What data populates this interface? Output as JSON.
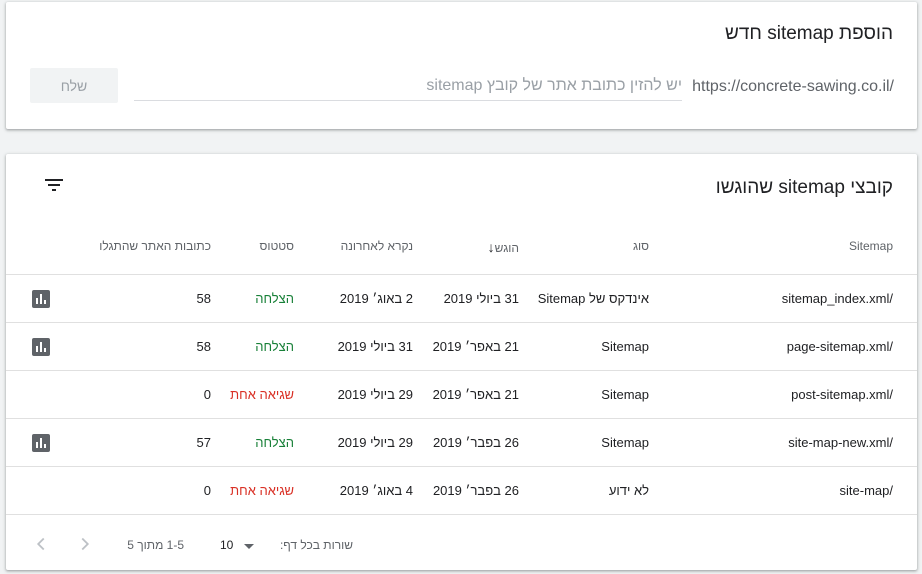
{
  "add_sitemap": {
    "title": "הוספת sitemap חדש",
    "url_prefix": "https://concrete-sawing.co.il/",
    "input_value": "",
    "input_placeholder": "יש להזין כתובת אתר של קובץ sitemap",
    "submit_label": "שלח"
  },
  "submitted_sitemaps": {
    "title": "קובצי sitemap שהוגשו",
    "filter_icon": "filter-icon",
    "columns": {
      "sitemap": "Sitemap",
      "type": "סוג",
      "submitted": "הוגש",
      "last_read": "נקרא לאחרונה",
      "status": "סטטוס",
      "discovered_urls": "כתובות האתר שהתגלו"
    },
    "sort_icon": "arrow-down-icon",
    "rows": [
      {
        "sitemap": "/sitemap_index.xml",
        "type": "אינדקס של Sitemap",
        "submitted": "31 ביולי 2019",
        "last_read": "2 באוג׳ 2019",
        "status": "הצלחה",
        "status_kind": "success",
        "discovered_urls": "58",
        "has_report": true
      },
      {
        "sitemap": "/page-sitemap.xml",
        "type": "Sitemap",
        "submitted": "21 באפר׳ 2019",
        "last_read": "31 ביולי 2019",
        "status": "הצלחה",
        "status_kind": "success",
        "discovered_urls": "58",
        "has_report": true
      },
      {
        "sitemap": "/post-sitemap.xml",
        "type": "Sitemap",
        "submitted": "21 באפר׳ 2019",
        "last_read": "29 ביולי 2019",
        "status": "שגיאה אחת",
        "status_kind": "error",
        "discovered_urls": "0",
        "has_report": false
      },
      {
        "sitemap": "/site-map-new.xml",
        "type": "Sitemap",
        "submitted": "26 בפבר׳ 2019",
        "last_read": "29 ביולי 2019",
        "status": "הצלחה",
        "status_kind": "success",
        "discovered_urls": "57",
        "has_report": true
      },
      {
        "sitemap": "/site-map",
        "type": "לא ידוע",
        "submitted": "26 בפבר׳ 2019",
        "last_read": "4 באוג׳ 2019",
        "status": "שגיאה אחת",
        "status_kind": "error",
        "discovered_urls": "0",
        "has_report": false
      }
    ],
    "pagination": {
      "rows_per_page_label": "שורות בכל דף:",
      "rows_per_page": "10",
      "range": "1-5 מתוך 5"
    }
  },
  "colors": {
    "success": "#188038",
    "error": "#d93025",
    "report_icon": "#5f6368"
  }
}
